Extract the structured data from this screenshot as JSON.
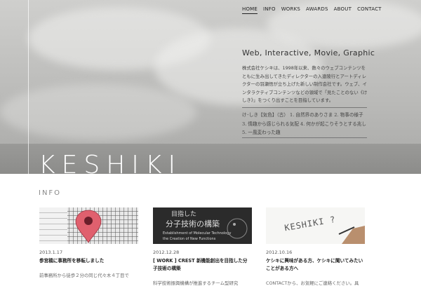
{
  "nav": {
    "items": [
      "HOME",
      "INFO",
      "WORKS",
      "AWARDS",
      "ABOUT",
      "CONTACT"
    ],
    "active": "HOME"
  },
  "hero": {
    "tagline": "Web, Interactive, Movie, Graphic",
    "intro": "株式会社ケシキは、1998年以来、数々のウェブコンテンツをともに生み出してきたディレクターの入遠陵行とアートディレクターの羽瀬悟が立ち上げた新しい制作会社です。ウェブ、インタラクティブコンテンツなどの領域で「見たことのない《けしき》」をつくり出すことを目指しています。",
    "definition": "け･しき【気色】（古） 1. 自然界のありさま 2. 物事の様子 3. 情趣から感じられる気配 4. 何かが起こりそうとする兆し 5. 一風変わった趣",
    "logo": "KESHIKI"
  },
  "info": {
    "heading": "INFO",
    "cards": [
      {
        "date": "2013.1.17",
        "title": "参宮橋に事務所を移転しました",
        "body": "前事務所から徒歩２分の同じ代々木４丁目で"
      },
      {
        "date": "2012.12.28",
        "title": "[ WORK ] CREST 新機能創出を目指した分子技術の構築",
        "body": "科学技術振興機構が推進するチーム型研究",
        "thumb_text": [
          "目指した",
          "分子技術の構築",
          "Establishment of Molecular Technology",
          "the Creation of New Functions"
        ]
      },
      {
        "date": "2012.10.16",
        "title": "ケシキに興味がある方、ケシキに聞いてみたいことがある方へ",
        "body": "CONTACTから、お気軽にご連絡ください。具",
        "thumb_text": "KESHIKI ?"
      }
    ]
  },
  "colors": {
    "pin": "#e0606e",
    "nav_text": "#222222",
    "logo": "#ffffff"
  }
}
